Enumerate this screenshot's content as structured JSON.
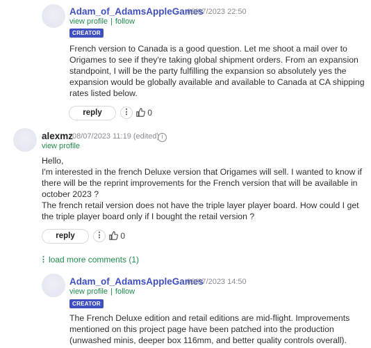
{
  "comments": [
    {
      "author": "Adam_of_AdamsAppleGames",
      "date": "08/07/2023 22:50",
      "view_profile": "view profile",
      "separator": "|",
      "follow": "follow",
      "badge": "CREATOR",
      "lines": [
        "French version to Canada is a good question.  Let me shoot a mail over to",
        "Origames to see if they're taking global shipment orders.  From an expansion",
        "standpoint, I will be the party fulfilling the expansion so absolutely yes the",
        "expansion would be globally available and available to Canada at CA shipping",
        "rates listed below."
      ],
      "reply_label": "reply",
      "more_label": "⋮",
      "likes": "0"
    },
    {
      "author": "alexmz",
      "date": "08/07/2023 11:19 (edited)",
      "info_icon": "i",
      "view_profile": "view profile",
      "lines": [
        "Hello,",
        "I'm interested in the french Deluxe version that Origames will sell. I wanted to know if",
        "there will be the reprint improvements for the French version that will be available in",
        "october 2023 ?",
        "The french retail version does not have the triple layer player board.  How could I get",
        "the triple player board only if I bought the retail version ?"
      ],
      "reply_label": "reply",
      "more_label": "⋮",
      "likes": "0"
    },
    {
      "author": "Adam_of_AdamsAppleGames",
      "date": "08/07/2023 14:50",
      "view_profile": "view profile",
      "separator": "|",
      "follow": "follow",
      "badge": "CREATOR",
      "lines": [
        "The French Deluxe edition and retail editions are mid-flight.  Improvements",
        "mentioned on this project page have been patched into the production",
        "(unwashed minis, deeper box 116mm, and better quality controls overall)."
      ]
    }
  ],
  "load_more": {
    "icon": "⋮",
    "label": "load more comments (1)"
  },
  "icons": {
    "like": "thumbs-up-icon",
    "more": "vertical-dots-icon",
    "info": "info-icon"
  },
  "colors": {
    "creator_name": "#3f4fc0",
    "link_green": "#1f8a4c",
    "badge_bg": "#3f4fc0"
  }
}
